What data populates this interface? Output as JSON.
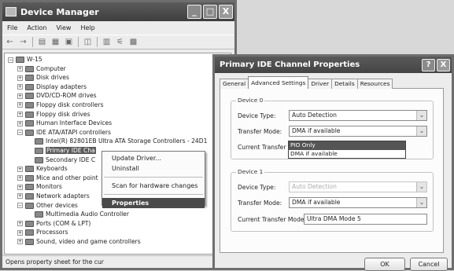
{
  "device_manager": {
    "title": "Device Manager",
    "menu": [
      "File",
      "Action",
      "View",
      "Help"
    ],
    "tree": {
      "root": "W-15",
      "items": [
        {
          "label": "Computer",
          "level": 1
        },
        {
          "label": "Disk drives",
          "level": 1
        },
        {
          "label": "Display adapters",
          "level": 1
        },
        {
          "label": "DVD/CD-ROM drives",
          "level": 1
        },
        {
          "label": "Floppy disk controllers",
          "level": 1
        },
        {
          "label": "Floppy disk drives",
          "level": 1
        },
        {
          "label": "Human Interface Devices",
          "level": 1
        },
        {
          "label": "IDE ATA/ATAPI controllers",
          "level": 1
        },
        {
          "label": "Intel(R) 82801EB Ultra ATA Storage Controllers - 24D1",
          "level": 2
        },
        {
          "label": "Primary IDE Cha",
          "level": 2
        },
        {
          "label": "Secondary IDE C",
          "level": 2
        },
        {
          "label": "Keyboards",
          "level": 1
        },
        {
          "label": "Mice and other point",
          "level": 1
        },
        {
          "label": "Monitors",
          "level": 1
        },
        {
          "label": "Network adapters",
          "level": 1
        },
        {
          "label": "Other devices",
          "level": 1
        },
        {
          "label": "Multimedia Audio Controller",
          "level": 2
        },
        {
          "label": "Ports (COM & LPT)",
          "level": 1
        },
        {
          "label": "Processors",
          "level": 1
        },
        {
          "label": "Sound, video and game controllers",
          "level": 1
        }
      ]
    },
    "status": "Opens property sheet for the cur",
    "context_menu": [
      "Update Driver...",
      "Uninstall",
      "Scan for hardware changes",
      "Properties"
    ]
  },
  "dialog": {
    "title": "Primary IDE Channel Properties",
    "help_label": "?",
    "close_label": "X",
    "tabs": [
      "General",
      "Advanced Settings",
      "Driver",
      "Details",
      "Resources"
    ],
    "device0": {
      "title": "Device 0",
      "device_type_label": "Device Type:",
      "device_type_value": "Auto Detection",
      "transfer_mode_label": "Transfer Mode:",
      "transfer_mode_value": "DMA if available",
      "current_label": "Current Transfer M",
      "dropdown_options": [
        "PIO Only",
        "DMA if available"
      ]
    },
    "device1": {
      "title": "Device 1",
      "device_type_label": "Device Type:",
      "device_type_value": "Auto Detection",
      "transfer_mode_label": "Transfer Mode:",
      "transfer_mode_value": "DMA if available",
      "current_label": "Current Transfer Mode:",
      "current_value": "Ultra DMA Mode 5"
    },
    "ok_label": "OK",
    "cancel_label": "Cancel"
  },
  "window_controls": {
    "minimize": "_",
    "maximize": "□",
    "close": "X"
  }
}
